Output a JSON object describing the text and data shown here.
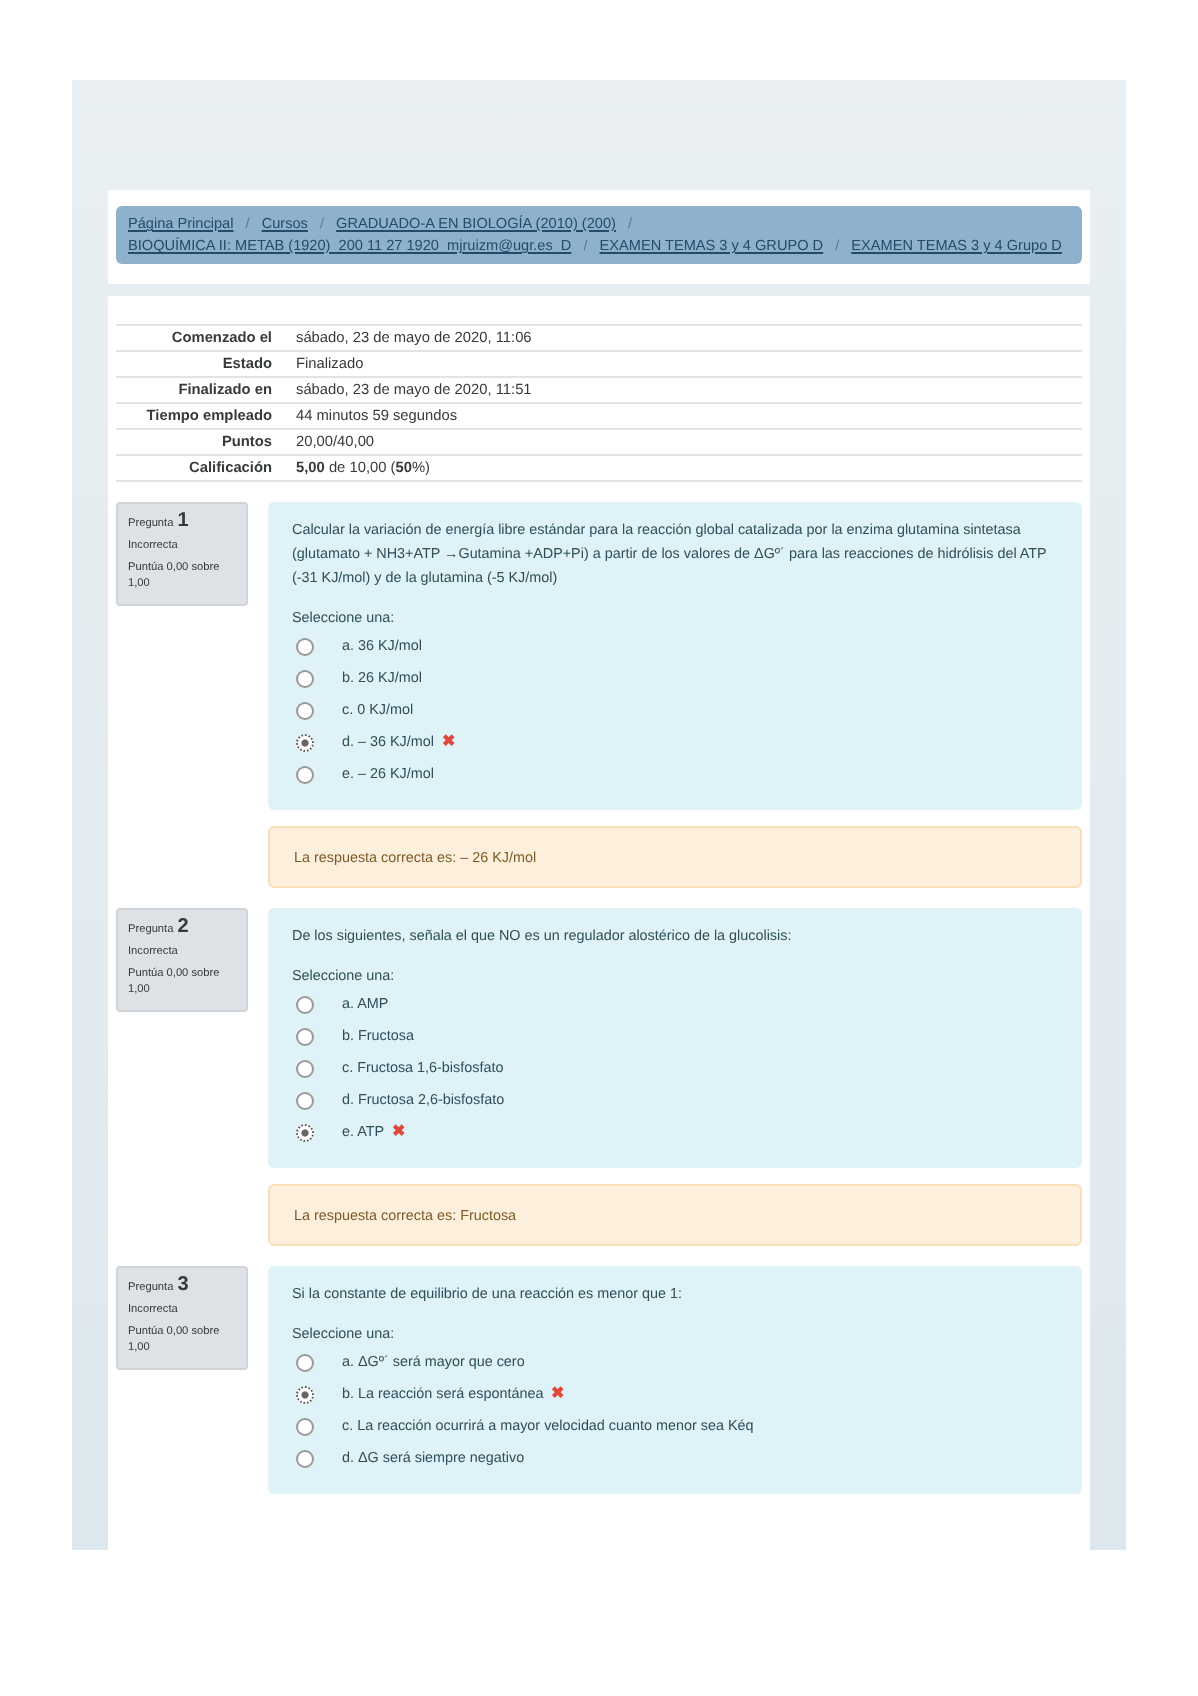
{
  "breadcrumb_separator": "/",
  "breadcrumb": [
    {
      "label": "Página Principal"
    },
    {
      "label": "Cursos"
    },
    {
      "label": "GRADUADO-A EN BIOLOGÍA (2010) (200)"
    },
    {
      "label": "BIOQUÍMICA II: METAB (1920)_200 11 27 1920_mjruizm@ugr.es_D"
    },
    {
      "label": "EXAMEN TEMAS 3 y 4 GRUPO D"
    },
    {
      "label": "EXAMEN TEMAS 3 y 4 Grupo D"
    }
  ],
  "summary": [
    {
      "label": "Comenzado el",
      "value": "sábado, 23 de mayo de 2020, 11:06"
    },
    {
      "label": "Estado",
      "value": "Finalizado"
    },
    {
      "label": "Finalizado en",
      "value": "sábado, 23 de mayo de 2020, 11:51"
    },
    {
      "label": "Tiempo empleado",
      "value": "44 minutos 59 segundos"
    },
    {
      "label": "Puntos",
      "value": "20,00/40,00"
    },
    {
      "label": "Calificación",
      "value": "**5,00** de 10,00 (**50**%)"
    }
  ],
  "questions": [
    {
      "heading": "Pregunta",
      "number": "1",
      "status": "Incorrecta",
      "score": "Puntúa 0,00 sobre 1,00",
      "text": "Calcular la variación de energía libre estándar para la reacción global catalizada por la enzima glutamina sintetasa (glutamato + NH3+ATP →Gutamina +ADP+Pi) a partir de los valores de ΔGº´ para las reacciones de hidrólisis del ATP (-31 KJ/mol) y de la glutamina (-5 KJ/mol)",
      "prompt": "Seleccione una:",
      "options": [
        {
          "label": "a. 36 KJ/mol",
          "selected": false
        },
        {
          "label": "b. 26 KJ/mol",
          "selected": false
        },
        {
          "label": "c. 0 KJ/mol",
          "selected": false
        },
        {
          "label": "d. – 36 KJ/mol",
          "selected": true,
          "mark": "✖"
        },
        {
          "label": "e. – 26 KJ/mol",
          "selected": false
        }
      ],
      "feedback": "La respuesta correcta es: – 26 KJ/mol"
    },
    {
      "heading": "Pregunta",
      "number": "2",
      "status": "Incorrecta",
      "score": "Puntúa 0,00 sobre 1,00",
      "text": "De los siguientes, señala el que NO es un regulador alostérico de la glucolisis:",
      "prompt": "Seleccione una:",
      "options": [
        {
          "label": "a. AMP",
          "selected": false
        },
        {
          "label": "b. Fructosa",
          "selected": false
        },
        {
          "label": "c. Fructosa 1,6-bisfosfato",
          "selected": false
        },
        {
          "label": "d. Fructosa 2,6-bisfosfato",
          "selected": false
        },
        {
          "label": "e. ATP",
          "selected": true,
          "mark": "✖"
        }
      ],
      "feedback": "La respuesta correcta es: Fructosa"
    },
    {
      "heading": "Pregunta",
      "number": "3",
      "status": "Incorrecta",
      "score": "Puntúa 0,00 sobre 1,00",
      "text": "Si la constante de equilibrio de una reacción es menor que 1:",
      "prompt": "Seleccione una:",
      "options": [
        {
          "label": "a. ΔGº´ será mayor que cero",
          "selected": false
        },
        {
          "label": "b. La reacción será espontánea",
          "selected": true,
          "mark": "✖"
        },
        {
          "label": "c. La reacción ocurrirá a mayor velocidad cuanto menor sea Kéq",
          "selected": false
        },
        {
          "label": "d. ΔG será siempre negativo",
          "selected": false
        }
      ]
    }
  ]
}
